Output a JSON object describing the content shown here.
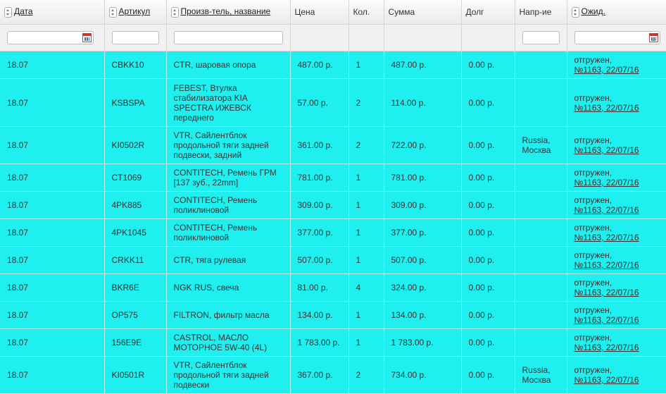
{
  "headers": {
    "date": "Дата",
    "article": "Артикул",
    "maker_name": "Произв-тель, название",
    "price": "Цена",
    "qty": "Кол.",
    "sum": "Сумма",
    "debt": "Долг",
    "direction": "Напр-ие",
    "expect": "Ожид."
  },
  "rows": [
    {
      "date": "18.07",
      "article": "CBKK10",
      "desc": "CTR, шаровая опора",
      "price": "487.00 р.",
      "qty": "1",
      "sum": "487.00 р.",
      "debt": "0.00 р.",
      "dir": "",
      "status": "отгружен,",
      "status_link": "№1163, 22/07/16"
    },
    {
      "date": "18.07",
      "article": "KSBSPA",
      "desc": "FEBEST, Втулка стабилизатора KIA SPECTRA ИЖЕВСК переднего",
      "price": "57.00 р.",
      "qty": "2",
      "sum": "114.00 р.",
      "debt": "0.00 р.",
      "dir": "",
      "status": "отгружен,",
      "status_link": "№1163, 22/07/16"
    },
    {
      "date": "18.07",
      "article": "KI0502R",
      "desc": "VTR, Сайлентблок продольной тяги задней подвески, задний",
      "price": "361.00 р.",
      "qty": "2",
      "sum": "722.00 р.",
      "debt": "0.00 р.",
      "dir": "Russia, Москва",
      "status": "отгружен,",
      "status_link": "№1163, 22/07/16"
    },
    {
      "date": "18.07",
      "article": "CT1069",
      "desc": "CONTITECH, Ремень ГРМ [137 зуб., 22mm]",
      "price": "781.00 р.",
      "qty": "1",
      "sum": "781.00 р.",
      "debt": "0.00 р.",
      "dir": "",
      "status": "отгружен,",
      "status_link": "№1163, 22/07/16"
    },
    {
      "date": "18.07",
      "article": "4PK885",
      "desc": "CONTITECH, Ремень поликлиновой",
      "price": "309.00 р.",
      "qty": "1",
      "sum": "309.00 р.",
      "debt": "0.00 р.",
      "dir": "",
      "status": "отгружен,",
      "status_link": "№1163, 22/07/16"
    },
    {
      "date": "18.07",
      "article": "4PK1045",
      "desc": "CONTITECH, Ремень поликлиновой",
      "price": "377.00 р.",
      "qty": "1",
      "sum": "377.00 р.",
      "debt": "0.00 р.",
      "dir": "",
      "status": "отгружен,",
      "status_link": "№1163, 22/07/16"
    },
    {
      "date": "18.07",
      "article": "CRKK11",
      "desc": "CTR, тяга рулевая",
      "price": "507.00 р.",
      "qty": "1",
      "sum": "507.00 р.",
      "debt": "0.00 р.",
      "dir": "",
      "status": "отгружен,",
      "status_link": "№1163, 22/07/16"
    },
    {
      "date": "18.07",
      "article": "BKR6E",
      "desc": "NGK RUS, свеча",
      "price": "81.00 р.",
      "qty": "4",
      "sum": "324.00 р.",
      "debt": "0.00 р.",
      "dir": "",
      "status": "отгружен,",
      "status_link": "№1163, 22/07/16"
    },
    {
      "date": "18.07",
      "article": "OP575",
      "desc": "FILTRON, фильтр масла",
      "price": "134.00 р.",
      "qty": "1",
      "sum": "134.00 р.",
      "debt": "0.00 р.",
      "dir": "",
      "status": "отгружен,",
      "status_link": "№1163, 22/07/16"
    },
    {
      "date": "18.07",
      "article": "156E9E",
      "desc": "CASTROL, МАСЛО МОТОРНОЕ 5W-40 (4L)",
      "price": "1 783.00 р.",
      "qty": "1",
      "sum": "1 783.00 р.",
      "debt": "0.00 р.",
      "dir": "",
      "status": "отгружен,",
      "status_link": "№1163, 22/07/16"
    },
    {
      "date": "18.07",
      "article": "KI0501R",
      "desc": "VTR, Сайлентблок продольной тяги задней подвески",
      "price": "367.00 р.",
      "qty": "2",
      "sum": "734.00 р.",
      "debt": "0.00 р.",
      "dir": "Russia, Москва",
      "status": "отгружен,",
      "status_link": "№1163, 22/07/16"
    }
  ],
  "colors": {
    "row_bg": "#1ff0ef",
    "header_bg": "#f1f1f1"
  }
}
